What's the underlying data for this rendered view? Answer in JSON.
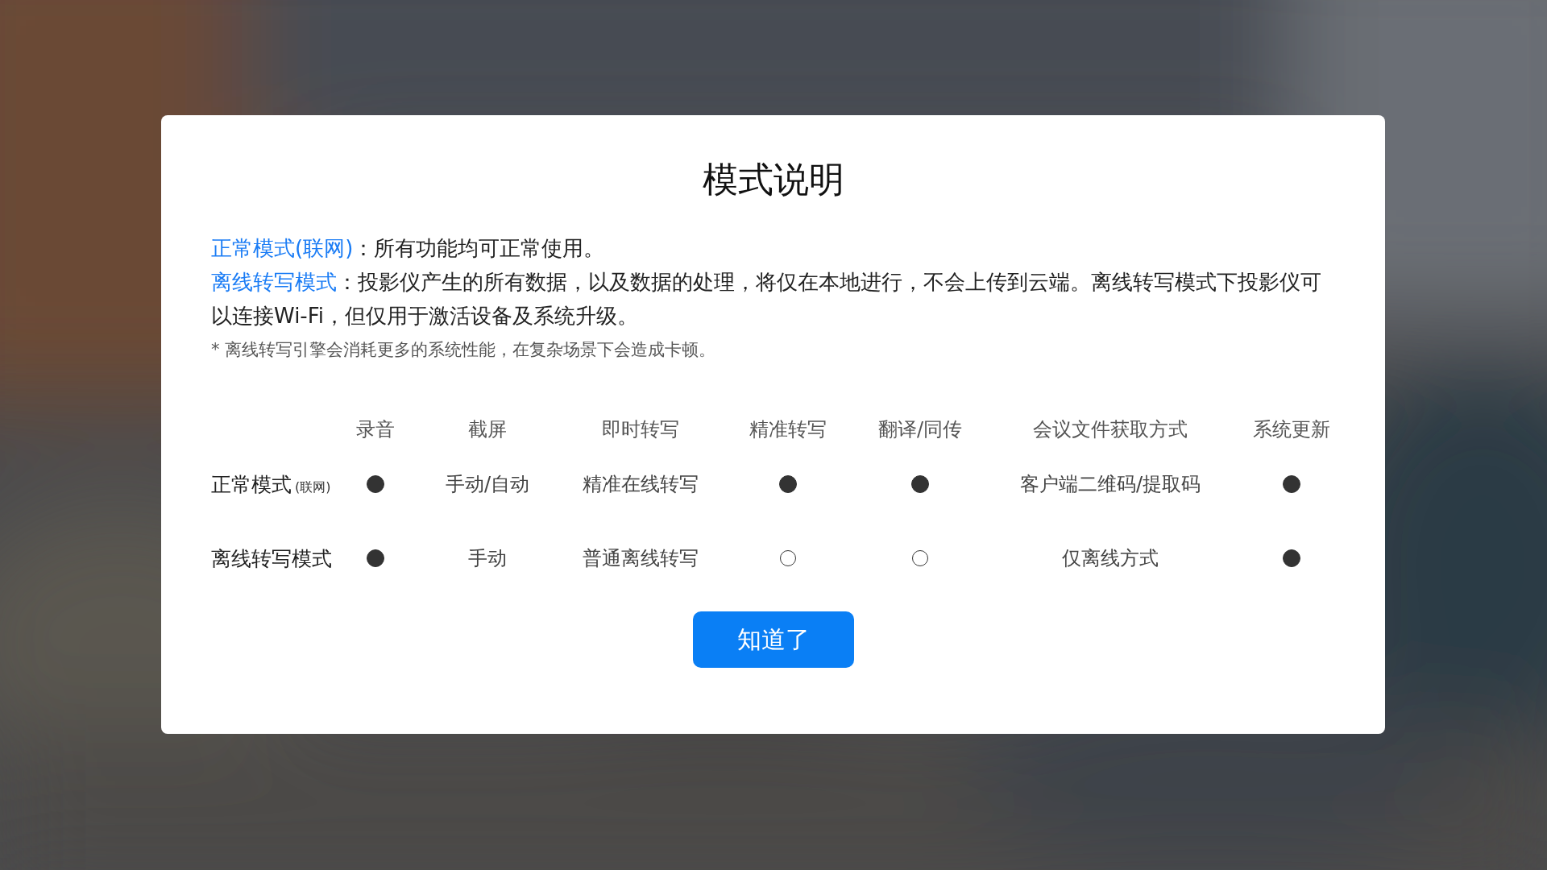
{
  "dialog": {
    "title": "模式说明",
    "descriptions": [
      {
        "term": "正常模式(联网)",
        "separator": "：",
        "text": "所有功能均可正常使用。"
      },
      {
        "term": "离线转写模式",
        "separator": "：",
        "text": "投影仪产生的所有数据，以及数据的处理，将仅在本地进行，不会上传到云端。离线转写模式下投影仪可以连接Wi-Fi，但仅用于激活设备及系统升级。"
      }
    ],
    "note": "* 离线转写引擎会消耗更多的系统性能，在复杂场景下会造成卡顿。",
    "table": {
      "columns": [
        "录音",
        "截屏",
        "即时转写",
        "精准转写",
        "翻译/同传",
        "会议文件获取方式",
        "系统更新"
      ],
      "rows": [
        {
          "label": "正常模式",
          "label_note": "(联网)",
          "cells": [
            {
              "kind": "dot",
              "supported": true
            },
            {
              "kind": "text",
              "text": "手动/自动"
            },
            {
              "kind": "text",
              "text": "精准在线转写"
            },
            {
              "kind": "dot",
              "supported": true
            },
            {
              "kind": "dot",
              "supported": true
            },
            {
              "kind": "text",
              "text": "客户端二维码/提取码"
            },
            {
              "kind": "dot",
              "supported": true
            }
          ]
        },
        {
          "label": "离线转写模式",
          "cells": [
            {
              "kind": "dot",
              "supported": true
            },
            {
              "kind": "text",
              "text": "手动"
            },
            {
              "kind": "text",
              "text": "普通离线转写"
            },
            {
              "kind": "dot",
              "supported": false
            },
            {
              "kind": "dot",
              "supported": false
            },
            {
              "kind": "text",
              "text": "仅离线方式"
            },
            {
              "kind": "dot",
              "supported": true
            }
          ]
        }
      ]
    },
    "button": "知道了"
  }
}
